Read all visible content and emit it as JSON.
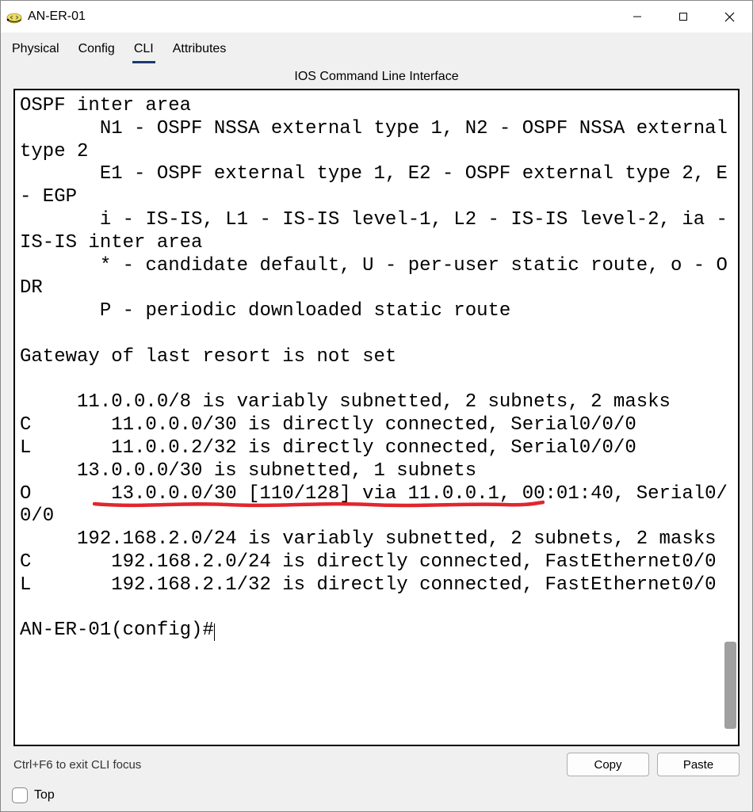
{
  "window": {
    "title": "AN-ER-01"
  },
  "tabs": {
    "0": {
      "label": "Physical"
    },
    "1": {
      "label": "Config"
    },
    "2": {
      "label": "CLI"
    },
    "3": {
      "label": "Attributes"
    }
  },
  "cli": {
    "subtitle": "IOS Command Line Interface",
    "text": "OSPF inter area\n       N1 - OSPF NSSA external type 1, N2 - OSPF NSSA external type 2\n       E1 - OSPF external type 1, E2 - OSPF external type 2, E - EGP\n       i - IS-IS, L1 - IS-IS level-1, L2 - IS-IS level-2, ia - IS-IS inter area\n       * - candidate default, U - per-user static route, o - ODR\n       P - periodic downloaded static route\n\nGateway of last resort is not set\n\n     11.0.0.0/8 is variably subnetted, 2 subnets, 2 masks\nC       11.0.0.0/30 is directly connected, Serial0/0/0\nL       11.0.0.2/32 is directly connected, Serial0/0/0\n     13.0.0.0/30 is subnetted, 1 subnets\nO       13.0.0.0/30 [110/128] via 11.0.0.1, 00:01:40, Serial0/0/0\n     192.168.2.0/24 is variably subnetted, 2 subnets, 2 masks\nC       192.168.2.0/24 is directly connected, FastEthernet0/0\nL       192.168.2.1/32 is directly connected, FastEthernet0/0\n\nAN-ER-01(config)#",
    "highlighted_route": "13.0.0.0/30 [110/128] via 11.0.0.1"
  },
  "help": {
    "hint": "Ctrl+F6 to exit CLI focus",
    "copy": "Copy",
    "paste": "Paste"
  },
  "footer": {
    "top_label": "Top"
  }
}
